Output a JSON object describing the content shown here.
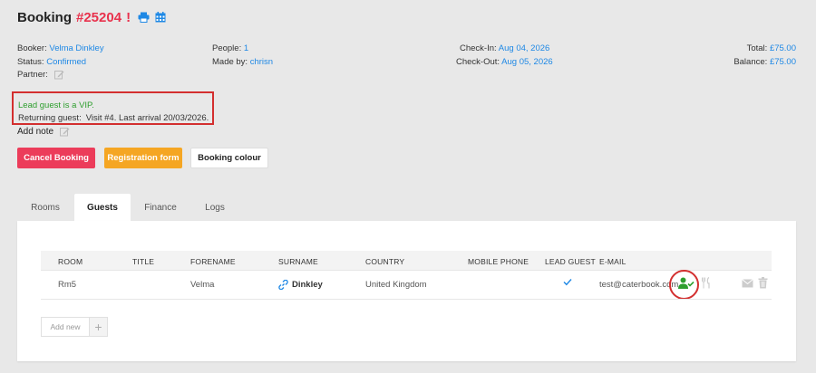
{
  "header": {
    "title": "Booking",
    "booking_number": "#25204",
    "alert_mark": "!",
    "icons": [
      "print-icon",
      "calendar-icon"
    ]
  },
  "details": {
    "booker_label": "Booker:",
    "booker_value": "Velma Dinkley",
    "status_label": "Status:",
    "status_value": "Confirmed",
    "partner_label": "Partner:",
    "people_label": "People:",
    "people_value": "1",
    "made_by_label": "Made by:",
    "made_by_value": "chrisn",
    "checkin_label": "Check-In:",
    "checkin_value": "Aug 04, 2026",
    "checkout_label": "Check-Out:",
    "checkout_value": "Aug 05, 2026",
    "total_label": "Total:",
    "total_value": "£75.00",
    "balance_label": "Balance:",
    "balance_value": "£75.00"
  },
  "notes": {
    "vip_text": "Lead guest is a VIP.",
    "returning_label": "Returning guest:",
    "returning_value": "Visit #4. Last arrival 20/03/2026.",
    "add_note_label": "Add note"
  },
  "actions": {
    "cancel_label": "Cancel Booking",
    "registration_label": "Registration form",
    "colour_label": "Booking colour"
  },
  "tabs": [
    {
      "label": "Rooms",
      "active": false
    },
    {
      "label": "Guests",
      "active": true
    },
    {
      "label": "Finance",
      "active": false
    },
    {
      "label": "Logs",
      "active": false
    }
  ],
  "guests_table": {
    "columns": [
      "ROOM",
      "TITLE",
      "FORENAME",
      "SURNAME",
      "COUNTRY",
      "MOBILE PHONE",
      "LEAD GUEST",
      "E-MAIL"
    ],
    "rows": [
      {
        "room": "Rm5",
        "title": "",
        "forename": "Velma",
        "surname": "Dinkley",
        "country": "United Kingdom",
        "mobile": "",
        "lead_guest": true,
        "email": "test@caterbook.com"
      }
    ],
    "add_new_label": "Add new",
    "add_plus": "+"
  },
  "colors": {
    "accent_red": "#e8324d",
    "link_blue": "#1e88e5",
    "vip_green": "#2e9e2e",
    "warning_orange": "#f5a623",
    "highlight_outline": "#d32f2f"
  }
}
